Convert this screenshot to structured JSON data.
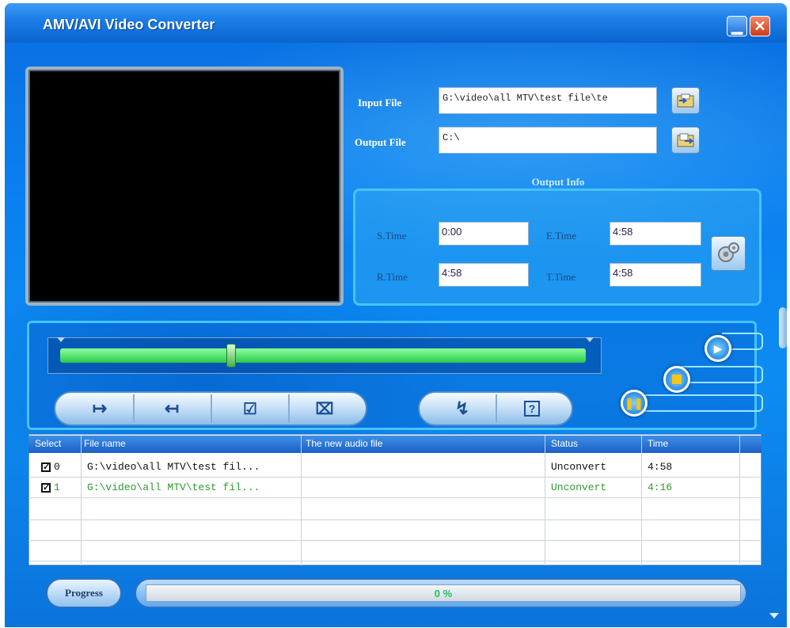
{
  "window": {
    "title": "AMV/AVI Video Converter"
  },
  "files": {
    "input_label": "Input File",
    "input_value": "G:\\video\\all MTV\\test file\\te",
    "output_label": "Output File",
    "output_value": "C:\\"
  },
  "output_info": {
    "title": "Output Info",
    "s_time_label": "S.Time",
    "s_time_value": "0:00",
    "e_time_label": "E.Time",
    "e_time_value": "4:58",
    "r_time_label": "R.Time",
    "r_time_value": "4:58",
    "t_time_label": "T.Time",
    "t_time_value": "4:58"
  },
  "table": {
    "headers": [
      "Select",
      "File name",
      "The new audio file",
      "Status",
      "Time"
    ],
    "rows": [
      {
        "index": "0",
        "file": "G:\\video\\all MTV\\test fil...",
        "audio": "",
        "status": "Unconvert",
        "time": "4:58",
        "color": "#111111"
      },
      {
        "index": "1",
        "file": "G:\\video\\all MTV\\test fil...",
        "audio": "",
        "status": "Unconvert",
        "time": "4:16",
        "color": "#2e9a2e"
      }
    ]
  },
  "progress": {
    "label": "Progress",
    "value": "0 %"
  },
  "colors": {
    "accent": "#0b7ff0",
    "progress_text": "#1fc15a"
  }
}
